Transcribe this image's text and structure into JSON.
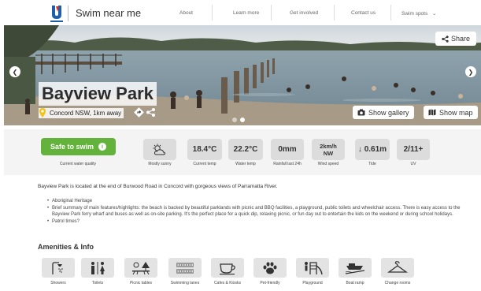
{
  "header": {
    "site_title": "Swim near me",
    "nav": [
      "About",
      "Learn more",
      "Get involved",
      "Contact us",
      "Swim spots"
    ],
    "chevron": "⌄"
  },
  "hero": {
    "title": "Bayview Park",
    "location": "Concord NSW, 1km away",
    "share_label": "Share",
    "gallery_label": "Show gallery",
    "map_label": "Show map",
    "slide_count": 2,
    "active_slide": 2
  },
  "conditions": {
    "safe_label": "Safe to swim",
    "safe_info": "i",
    "safe_caption": "Current water quality",
    "items": [
      {
        "value": "",
        "caption": "Mostly sunny",
        "icon": "sun-cloud-icon"
      },
      {
        "value": "18.4°C",
        "caption": "Current temp"
      },
      {
        "value": "22.2°C",
        "caption": "Water temp"
      },
      {
        "value": "0mm",
        "caption": "Rainfall last 24h"
      },
      {
        "value": "2km/h\nNW",
        "caption": "Wind speed"
      },
      {
        "value": "↓ 0.61m",
        "caption": "Tide"
      },
      {
        "value": "2/11+",
        "caption": "UV"
      }
    ]
  },
  "description": {
    "intro": "Bayview Park is located at the end of Burwood Road in Concord with gorgeous views of Parramatta River.",
    "bullets": [
      "Aboriginal Heritage",
      "Brief summary of main features/highlights: the beach is backed by beautiful parklands with picnic and BBQ facilities, a playground, public toilets and wheelchair access. There is easy access to the Bayview Park ferry wharf and buses as well as on-site parking. It's the perfect place for a quick dip, relaxing picnic, or fun day out to entertain the kids on the weekend or during school holidays.",
      "Patrol times?"
    ]
  },
  "amenities": {
    "title": "Amenities & Info",
    "items": [
      {
        "label": "Showers",
        "icon": "shower-icon"
      },
      {
        "label": "Toilets",
        "icon": "toilets-icon"
      },
      {
        "label": "Picnic tables",
        "icon": "picnic-icon"
      },
      {
        "label": "Swimming lanes",
        "icon": "lanes-icon"
      },
      {
        "label": "Cafes & Kiosks",
        "icon": "cafe-icon"
      },
      {
        "label": "Pet-friendly",
        "icon": "paw-icon"
      },
      {
        "label": "Playground",
        "icon": "playground-icon"
      },
      {
        "label": "Boat ramp",
        "icon": "boat-ramp-icon"
      },
      {
        "label": "Change rooms",
        "icon": "hanger-icon"
      }
    ]
  },
  "colors": {
    "safe_green": "#63b23c",
    "logo_blue": "#1f5fa8",
    "logo_red": "#d8342c"
  }
}
